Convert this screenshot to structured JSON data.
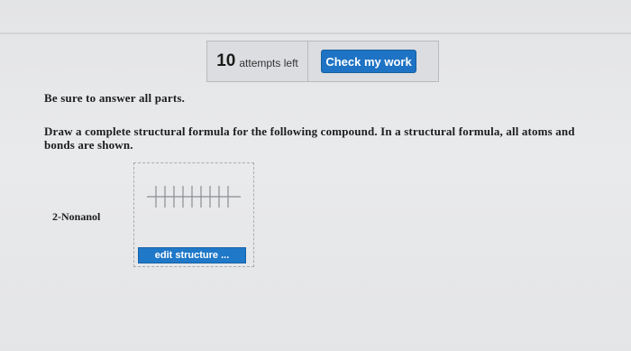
{
  "toolbar": {
    "attempts_count": "10",
    "attempts_label": "attempts left",
    "check_button": "Check my work"
  },
  "question": {
    "instruction": "Be sure to answer all parts.",
    "prompt": "Draw a complete structural formula for the following compound. In a structural formula, all atoms and bonds are shown.",
    "compound_name": "2-Nonanol",
    "edit_button": "edit structure ..."
  },
  "colors": {
    "primary_button": "#1e73c4",
    "background": "#e6e7e9"
  },
  "icons": [
    "carbon-chain-icon"
  ]
}
